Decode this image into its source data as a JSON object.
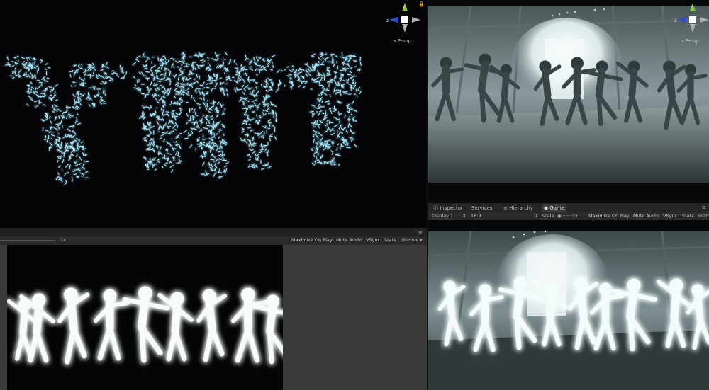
{
  "scene_top_left": {
    "persp_label": "Persp",
    "axis_y": "y",
    "axis_z": "z"
  },
  "scene_top_right": {
    "persp_label": "Persp",
    "axis_y": "y",
    "axis_z": "z"
  },
  "game_tabs": [
    {
      "label": "Inspector",
      "icon": "info-icon",
      "active": false
    },
    {
      "label": "Services",
      "icon": "",
      "active": false
    },
    {
      "label": "Hierarchy",
      "icon": "list-icon",
      "active": false
    },
    {
      "label": "Game",
      "icon": "game-icon",
      "active": true
    }
  ],
  "game_toolbar_right": {
    "display": "Display 1",
    "aspect": "16:9",
    "scale_label": "Scale",
    "scale_value": "1x",
    "maximize": "Maximize On Play",
    "mute": "Mute Audio",
    "vsync": "VSync",
    "stats": "Stats",
    "gizmos": "Gizm"
  },
  "game_toolbar_left": {
    "scale_value": "1x",
    "maximize": "Maximize On Play",
    "mute": "Mute Audio",
    "vsync": "VSync",
    "stats": "Stats",
    "gizmos": "Gizmos"
  },
  "colors": {
    "particle": "#9fe6ff",
    "glow": "#dff6f8",
    "panel": "#3a3a3a",
    "toolbar": "#2b2b2b"
  }
}
